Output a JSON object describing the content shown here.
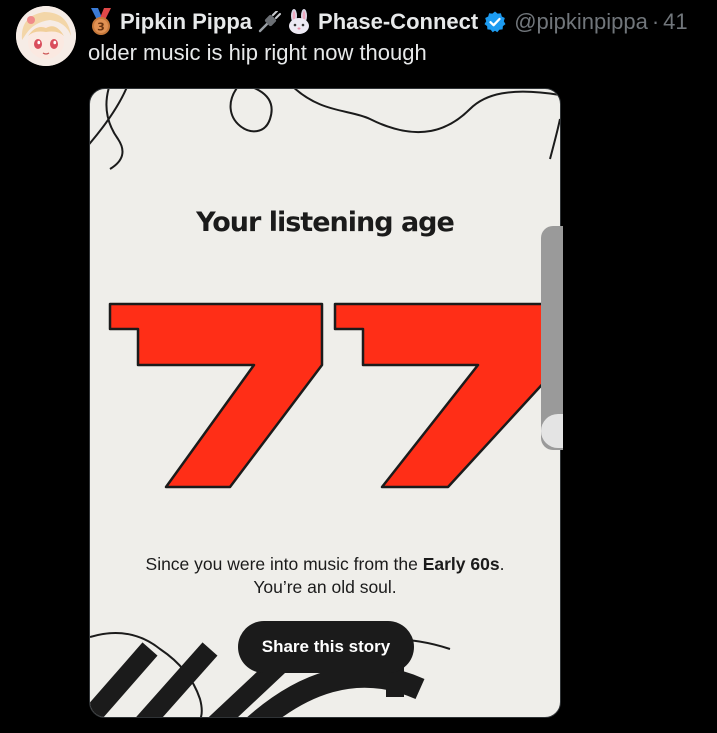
{
  "author": {
    "display_name": "Pipkin Pippa",
    "org_name": "Phase-Connect",
    "handle": "@pipkinpippa",
    "separator": "·",
    "time": "41",
    "medal_icon": "bronze-medal-icon",
    "plug_icon": "plug-icon",
    "bunny_icon": "rabbit-face-icon",
    "verified_icon": "verified-badge-icon",
    "verified_color": "#1d9bf0"
  },
  "tweet": {
    "text": "older music is hip right now though"
  },
  "story": {
    "title": "Your listening age",
    "age": "77",
    "age_color": "#ff2e17",
    "caption_prefix": "Since you were into music from the ",
    "caption_bold": "Early 60s",
    "caption_suffix": ". You’re an old soul.",
    "share_label": "Share this story",
    "background_color": "#efeeea"
  }
}
